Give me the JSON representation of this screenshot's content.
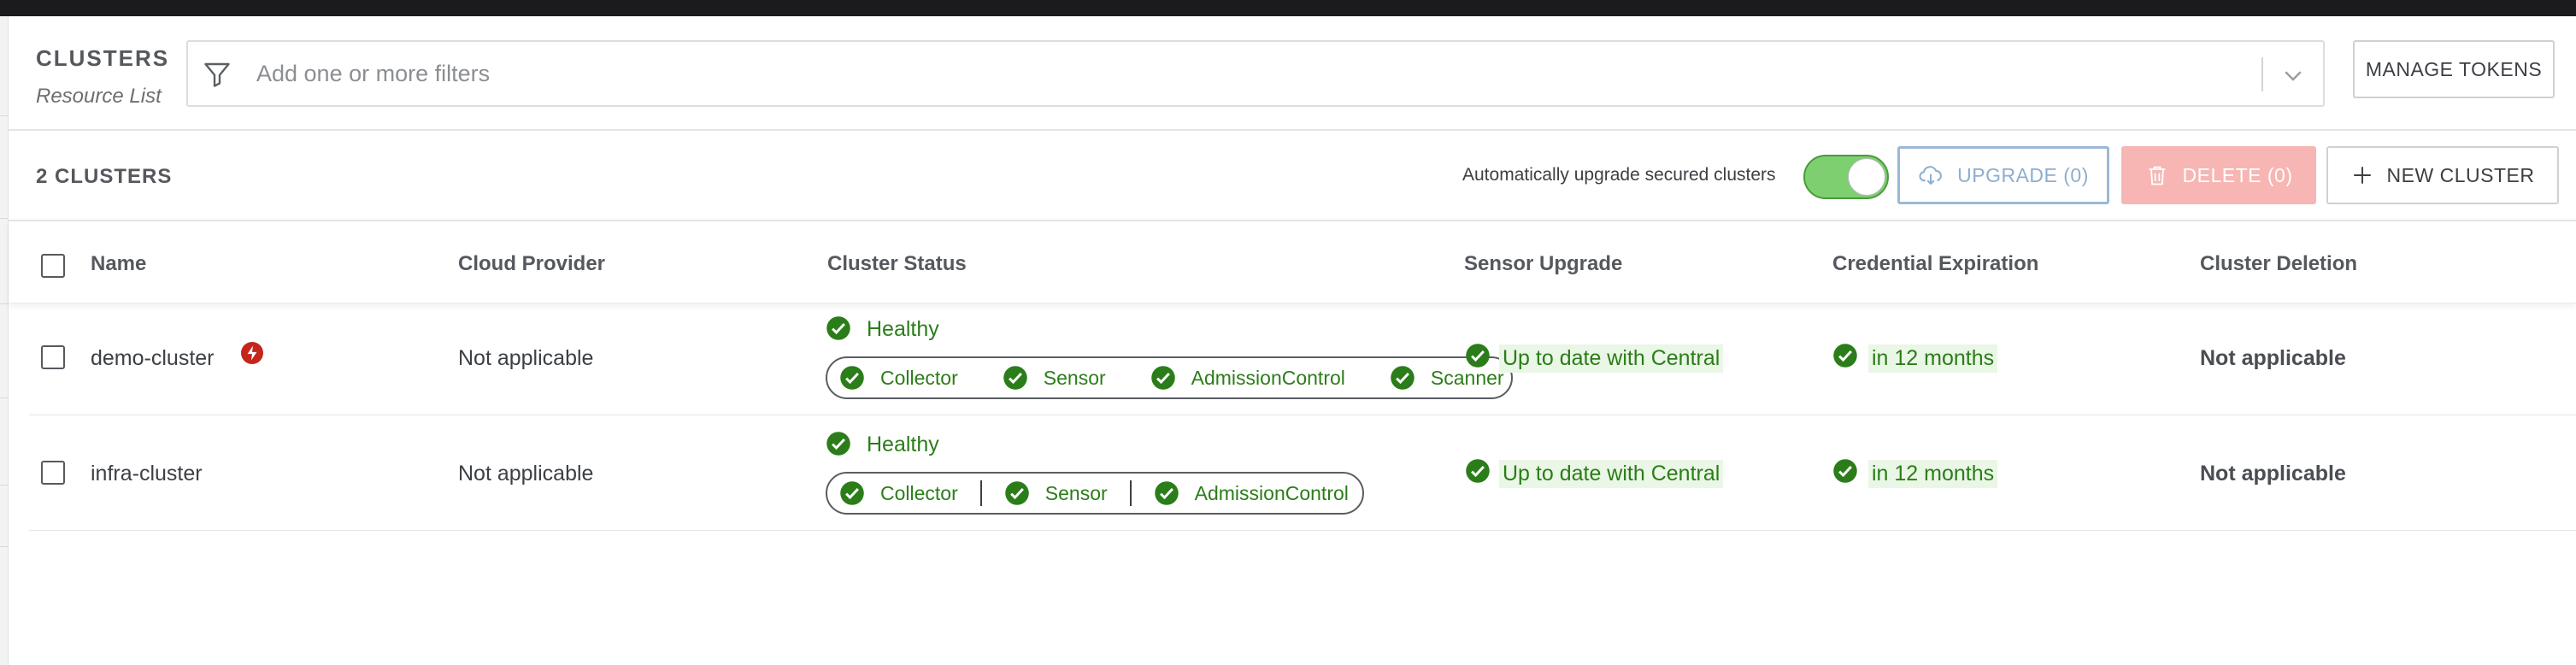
{
  "header": {
    "title": "CLUSTERS",
    "subtitle": "Resource List",
    "filter_placeholder": "Add one or more filters",
    "manage_tokens": "MANAGE TOKENS"
  },
  "toolbar": {
    "count": "2 CLUSTERS",
    "auto_upgrade_label": "Automatically upgrade secured clusters",
    "auto_upgrade_enabled": true,
    "upgrade": "UPGRADE (0)",
    "delete": "DELETE (0)",
    "new_cluster": "NEW CLUSTER"
  },
  "columns": [
    "Name",
    "Cloud Provider",
    "Cluster Status",
    "Sensor Upgrade",
    "Credential Expiration",
    "Cluster Deletion"
  ],
  "rows": [
    {
      "name": "demo-cluster",
      "cloud_provider": "Not applicable",
      "status": "Healthy",
      "components": [
        "Collector",
        "Sensor",
        "AdmissionControl",
        "Scanner"
      ],
      "sensor_upgrade": "Up to date with Central",
      "credential_expiration": "in 12 months",
      "cluster_deletion": "Not applicable"
    },
    {
      "name": "infra-cluster",
      "cloud_provider": "Not applicable",
      "status": "Healthy",
      "components": [
        "Collector",
        "Sensor",
        "AdmissionControl"
      ],
      "sensor_upgrade": "Up to date with Central",
      "credential_expiration": "in 12 months",
      "cluster_deletion": "Not applicable"
    }
  ],
  "colors": {
    "healthy": "#2b7d19",
    "toggle_on": "#7dcf6f",
    "delete_disabled": "#f7b6b3",
    "upgrade_border": "#9ab8d6",
    "alert": "#c4261c"
  }
}
